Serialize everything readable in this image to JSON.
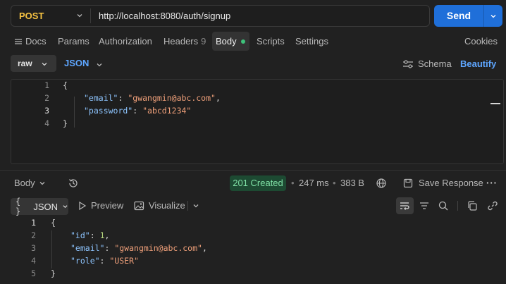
{
  "request": {
    "method": "POST",
    "url": "http://localhost:8080/auth/signup",
    "send_label": "Send"
  },
  "tabs": [
    {
      "label": "Docs"
    },
    {
      "label": "Params"
    },
    {
      "label": "Authorization"
    },
    {
      "label": "Headers",
      "count": "9"
    },
    {
      "label": "Body"
    },
    {
      "label": "Scripts"
    },
    {
      "label": "Settings"
    }
  ],
  "cookies_label": "Cookies",
  "body_options": {
    "mode": "raw",
    "language": "JSON",
    "schema_label": "Schema",
    "beautify_label": "Beautify"
  },
  "request_body": {
    "line_numbers": [
      "1",
      "2",
      "3",
      "4"
    ],
    "open_brace": "{",
    "close_brace": "}",
    "fields": [
      {
        "key": "\"email\"",
        "value": "\"gwangmin@abc.com\"",
        "sep": ",",
        "type": "string"
      },
      {
        "key": "\"password\"",
        "value": "\"abcd1234\"",
        "sep": "",
        "type": "string"
      }
    ]
  },
  "response": {
    "body_label": "Body",
    "status": "201 Created",
    "time": "247 ms",
    "size": "383 B",
    "save_label": "Save Response",
    "format_label": "JSON",
    "format_prefix": "{ }",
    "preview_label": "Preview",
    "visualize_label": "Visualize",
    "line_numbers": [
      "1",
      "2",
      "3",
      "4",
      "5"
    ],
    "open_brace": "{",
    "close_brace": "}",
    "fields": [
      {
        "key": "\"id\"",
        "value": "1",
        "sep": ",",
        "type": "number"
      },
      {
        "key": "\"email\"",
        "value": "\"gwangmin@abc.com\"",
        "sep": ",",
        "type": "string"
      },
      {
        "key": "\"role\"",
        "value": "\"USER\"",
        "sep": "",
        "type": "string"
      }
    ]
  },
  "colors": {
    "accent": "#1f6fd9",
    "method": "#f5c242",
    "status_bg": "#1d4a32",
    "status_text": "#7fe0a5",
    "link": "#5ea6ff"
  }
}
